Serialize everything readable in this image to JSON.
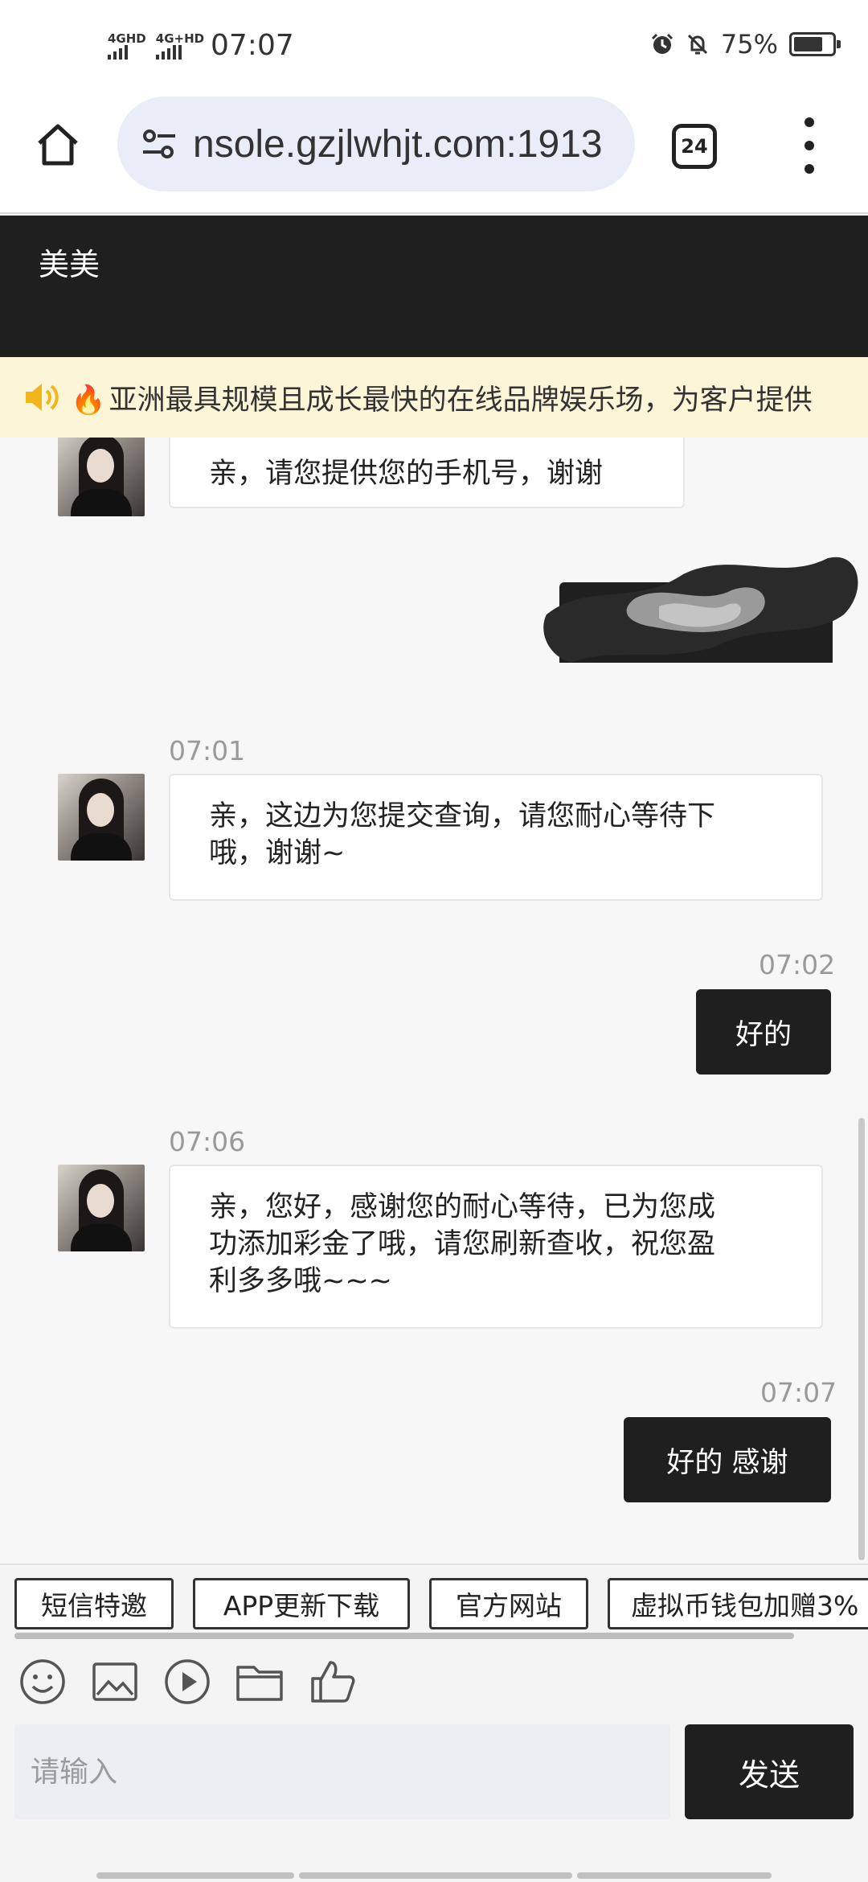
{
  "status_bar": {
    "net1": "4GHD",
    "net2": "4G+HD",
    "time": "07:07",
    "battery_text": "75%",
    "battery_level": 0.75
  },
  "browser": {
    "url": "nsole.gzjlwhjt.com:1913",
    "tab_count": "24"
  },
  "chat": {
    "title": "美美",
    "marquee": "亚洲最具规模且成长最快的在线品牌娱乐场，为客户提供"
  },
  "messages": {
    "m1": "亲，请您提供您的手机号，谢谢",
    "ts1": "07:01",
    "m2_line1": "亲，这边为您提交查询，请您耐心等待下",
    "m2_line2": "哦，谢谢~",
    "ts2": "07:02",
    "m3": "好的",
    "ts3": "07:06",
    "m4_line1": "亲，您好，感谢您的耐心等待，已为您成",
    "m4_line2": "功添加彩金了哦，请您刷新查收，祝您盈",
    "m4_line3": "利多多哦~~~",
    "ts4": "07:07",
    "m5": "好的 感谢"
  },
  "quick_buttons": [
    "短信特邀",
    "APP更新下载",
    "官方网站",
    "虚拟币钱包加赠3%"
  ],
  "toolbar_icons": [
    "emoji-icon",
    "image-icon",
    "video-icon",
    "folder-icon",
    "thumbs-up-icon"
  ],
  "composer": {
    "placeholder": "请输入",
    "send_label": "发送"
  },
  "colors": {
    "header_bg": "#1f1f1f",
    "marquee_bg": "#fdf5d8",
    "url_bg": "#e8edf8",
    "outgoing_bubble": "#1f1f1f"
  }
}
